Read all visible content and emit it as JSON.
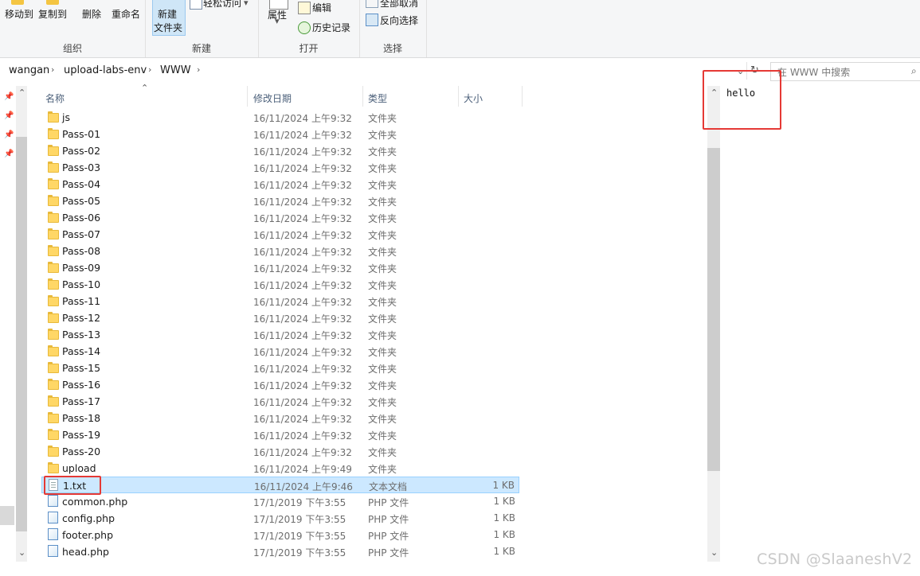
{
  "ribbon": {
    "groups": {
      "organize": {
        "label": "组织",
        "move_to": "移动到",
        "copy_to": "复制到",
        "delete": "删除",
        "rename": "重命名"
      },
      "new": {
        "label": "新建",
        "new_folder_line1": "新建",
        "new_folder_line2": "文件夹",
        "easy_access": "轻松访问"
      },
      "open": {
        "label": "打开",
        "properties": "属性",
        "edit": "编辑",
        "history": "历史记录"
      },
      "select": {
        "label": "选择",
        "select_all": "全部取消",
        "invert": "反向选择"
      }
    }
  },
  "address": {
    "crumbs": [
      "wangan",
      "upload-labs-env",
      "WWW"
    ]
  },
  "search": {
    "placeholder": "在 WWW 中搜索"
  },
  "columns": {
    "name": "名称",
    "modified": "修改日期",
    "type": "类型",
    "size": "大小"
  },
  "files": [
    {
      "name": "js",
      "modified": "16/11/2024 上午9:32",
      "type": "文件夹",
      "size": "",
      "kind": "folder"
    },
    {
      "name": "Pass-01",
      "modified": "16/11/2024 上午9:32",
      "type": "文件夹",
      "size": "",
      "kind": "folder"
    },
    {
      "name": "Pass-02",
      "modified": "16/11/2024 上午9:32",
      "type": "文件夹",
      "size": "",
      "kind": "folder"
    },
    {
      "name": "Pass-03",
      "modified": "16/11/2024 上午9:32",
      "type": "文件夹",
      "size": "",
      "kind": "folder"
    },
    {
      "name": "Pass-04",
      "modified": "16/11/2024 上午9:32",
      "type": "文件夹",
      "size": "",
      "kind": "folder"
    },
    {
      "name": "Pass-05",
      "modified": "16/11/2024 上午9:32",
      "type": "文件夹",
      "size": "",
      "kind": "folder"
    },
    {
      "name": "Pass-06",
      "modified": "16/11/2024 上午9:32",
      "type": "文件夹",
      "size": "",
      "kind": "folder"
    },
    {
      "name": "Pass-07",
      "modified": "16/11/2024 上午9:32",
      "type": "文件夹",
      "size": "",
      "kind": "folder"
    },
    {
      "name": "Pass-08",
      "modified": "16/11/2024 上午9:32",
      "type": "文件夹",
      "size": "",
      "kind": "folder"
    },
    {
      "name": "Pass-09",
      "modified": "16/11/2024 上午9:32",
      "type": "文件夹",
      "size": "",
      "kind": "folder"
    },
    {
      "name": "Pass-10",
      "modified": "16/11/2024 上午9:32",
      "type": "文件夹",
      "size": "",
      "kind": "folder"
    },
    {
      "name": "Pass-11",
      "modified": "16/11/2024 上午9:32",
      "type": "文件夹",
      "size": "",
      "kind": "folder"
    },
    {
      "name": "Pass-12",
      "modified": "16/11/2024 上午9:32",
      "type": "文件夹",
      "size": "",
      "kind": "folder"
    },
    {
      "name": "Pass-13",
      "modified": "16/11/2024 上午9:32",
      "type": "文件夹",
      "size": "",
      "kind": "folder"
    },
    {
      "name": "Pass-14",
      "modified": "16/11/2024 上午9:32",
      "type": "文件夹",
      "size": "",
      "kind": "folder"
    },
    {
      "name": "Pass-15",
      "modified": "16/11/2024 上午9:32",
      "type": "文件夹",
      "size": "",
      "kind": "folder"
    },
    {
      "name": "Pass-16",
      "modified": "16/11/2024 上午9:32",
      "type": "文件夹",
      "size": "",
      "kind": "folder"
    },
    {
      "name": "Pass-17",
      "modified": "16/11/2024 上午9:32",
      "type": "文件夹",
      "size": "",
      "kind": "folder"
    },
    {
      "name": "Pass-18",
      "modified": "16/11/2024 上午9:32",
      "type": "文件夹",
      "size": "",
      "kind": "folder"
    },
    {
      "name": "Pass-19",
      "modified": "16/11/2024 上午9:32",
      "type": "文件夹",
      "size": "",
      "kind": "folder"
    },
    {
      "name": "Pass-20",
      "modified": "16/11/2024 上午9:32",
      "type": "文件夹",
      "size": "",
      "kind": "folder"
    },
    {
      "name": "upload",
      "modified": "16/11/2024 上午9:49",
      "type": "文件夹",
      "size": "",
      "kind": "folder"
    },
    {
      "name": "1.txt",
      "modified": "16/11/2024 上午9:46",
      "type": "文本文档",
      "size": "1 KB",
      "kind": "txt",
      "selected": true
    },
    {
      "name": "common.php",
      "modified": "17/1/2019 下午3:55",
      "type": "PHP 文件",
      "size": "1 KB",
      "kind": "php"
    },
    {
      "name": "config.php",
      "modified": "17/1/2019 下午3:55",
      "type": "PHP 文件",
      "size": "1 KB",
      "kind": "php"
    },
    {
      "name": "footer.php",
      "modified": "17/1/2019 下午3:55",
      "type": "PHP 文件",
      "size": "1 KB",
      "kind": "php"
    },
    {
      "name": "head.php",
      "modified": "17/1/2019 下午3:55",
      "type": "PHP 文件",
      "size": "1 KB",
      "kind": "php"
    }
  ],
  "preview": {
    "text": "hello"
  },
  "watermark": "CSDN @SlaaneshV2",
  "colors": {
    "selection": "#cce8ff",
    "highlight_box": "#e53935",
    "folder": "#ffd766"
  }
}
